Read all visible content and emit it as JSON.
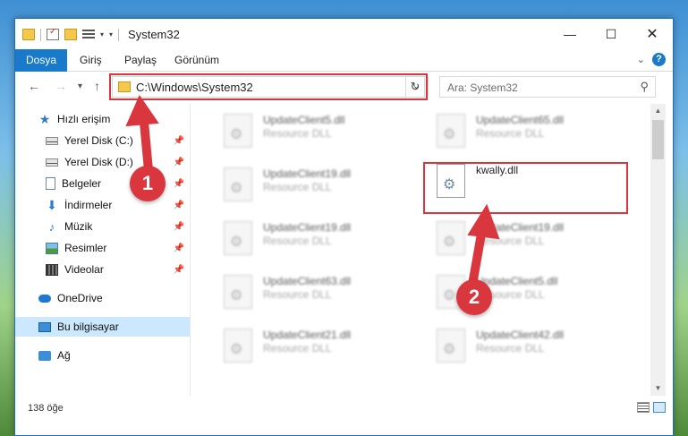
{
  "window": {
    "title": "System32",
    "controls": {
      "minimize": "—",
      "maximize": "☐",
      "close": "✕"
    }
  },
  "ribbon": {
    "tabs": [
      {
        "label": "Dosya",
        "active": true
      },
      {
        "label": "Giriş"
      },
      {
        "label": "Paylaş"
      },
      {
        "label": "Görünüm"
      }
    ],
    "help": "?"
  },
  "nav": {
    "back": "←",
    "forward": "→",
    "recent": "▾",
    "up": "↑",
    "address": "C:\\Windows\\System32",
    "address_dropdown": "⌄",
    "refresh": "↻",
    "search_placeholder": "Ara: System32"
  },
  "sidebar": {
    "items": [
      {
        "label": "Hızlı erişim",
        "icon": "star-icon"
      },
      {
        "label": "Yerel Disk (C:)",
        "icon": "disk-icon",
        "pinned": true
      },
      {
        "label": "Yerel Disk (D:)",
        "icon": "disk-icon",
        "pinned": true
      },
      {
        "label": "Belgeler",
        "icon": "document-icon",
        "pinned": true
      },
      {
        "label": "İndirmeler",
        "icon": "download-icon",
        "pinned": true
      },
      {
        "label": "Müzik",
        "icon": "music-icon",
        "pinned": true
      },
      {
        "label": "Resimler",
        "icon": "pictures-icon",
        "pinned": true
      },
      {
        "label": "Videolar",
        "icon": "videos-icon",
        "pinned": true
      },
      {
        "label": "OneDrive",
        "icon": "onedrive-icon"
      },
      {
        "label": "Bu bilgisayar",
        "icon": "computer-icon",
        "selected": true
      },
      {
        "label": "Ağ",
        "icon": "network-icon"
      }
    ]
  },
  "files": [
    {
      "name": "UpdateClient5.dll",
      "desc": "Resource DLL"
    },
    {
      "name": "UpdateClient65.dll",
      "desc": "Resource DLL"
    },
    {
      "name": "UpdateClient19.dll",
      "desc": "Resource DLL"
    },
    {
      "name": "kwally.dll",
      "desc": "",
      "highlighted": true
    },
    {
      "name": "UpdateClient19.dll",
      "desc": "Resource DLL"
    },
    {
      "name": "UpdateClient19.dll",
      "desc": "Resource DLL"
    },
    {
      "name": "UpdateClient63.dll",
      "desc": "Resource DLL"
    },
    {
      "name": "UpdateClient5.dll",
      "desc": "Resource DLL"
    },
    {
      "name": "UpdateClient21.dll",
      "desc": "Resource DLL"
    },
    {
      "name": "UpdateClient42.dll",
      "desc": "Resource DLL"
    }
  ],
  "status": {
    "item_count": "138 öğe"
  },
  "annotations": {
    "step1": "1",
    "step2": "2",
    "accent": "#d9363e"
  }
}
